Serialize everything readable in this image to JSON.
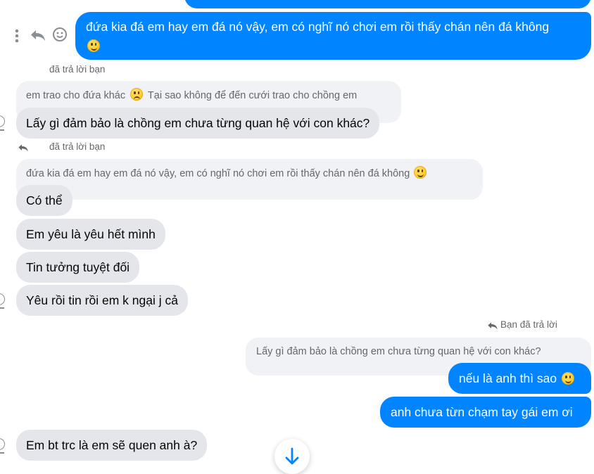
{
  "messages": {
    "m1_out": "đứa kia đá em hay em đá nó vậy, em có nghĩ nó chơi em rồi thấy chán nên đá không",
    "reply1_label": "đã trả lời bạn",
    "quote1_text_a": "em trao cho đứa khác",
    "quote1_text_b": "Tại sao không để đến cưới trao cho chồng em",
    "m2_in": "Lấy gì đảm bảo là chồng em chưa từng quan hệ với con khác?",
    "reply2_label": "đã trả lời bạn",
    "quote2_text": "đứa kia đá em hay em đá nó vậy, em có nghĩ nó chơi em rồi thấy chán nên đá không",
    "m3_in": "Có thể",
    "m4_in": "Em yêu là yêu hết mình",
    "m5_in": "Tin tưởng tuyệt đối",
    "m6_in": "Yêu rồi tin rồi em k ngại j cả",
    "reply3_label": "Bạn đã trả lời",
    "quote3_text": "Lấy gì đảm bảo là chồng em chưa từng quan hệ với con khác?",
    "m7_out": "nếu là anh thì sao",
    "m8_out": "anh chưa từn chạm tay gái em ơi",
    "m9_in": "Em bt trc là em sẽ quen anh à?"
  },
  "colors": {
    "outgoing": "#0084ff",
    "incoming": "#e4e6eb",
    "quote": "#f0f2f5",
    "meta_text": "#65676b"
  },
  "icons": [
    "more-options-icon",
    "reply-icon",
    "react-smiley-icon",
    "scroll-down-arrow-icon"
  ]
}
